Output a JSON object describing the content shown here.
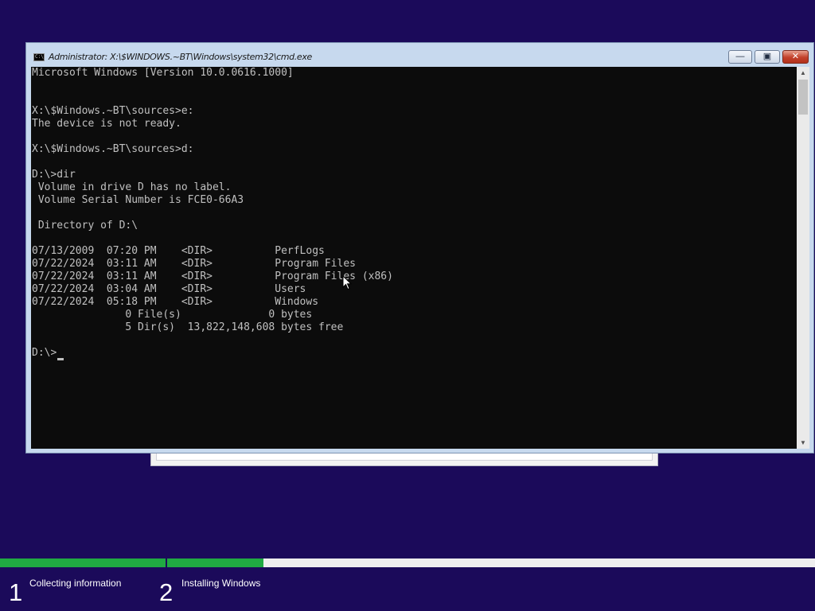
{
  "window": {
    "title": "Administrator: X:\\$WINDOWS.~BT\\Windows\\system32\\cmd.exe",
    "icon_text": "C:\\",
    "minimize_icon": "minimize-icon",
    "maximize_icon": "maximize-icon",
    "close_icon": "close-icon",
    "minimize_glyph": "—",
    "maximize_glyph": "▣",
    "close_glyph": "✕"
  },
  "console": {
    "lines": [
      "Microsoft Windows [Version 10.0.0616.1000]",
      "",
      "",
      "X:\\$Windows.~BT\\sources>e:",
      "The device is not ready.",
      "",
      "X:\\$Windows.~BT\\sources>d:",
      "",
      "D:\\>dir",
      " Volume in drive D has no label.",
      " Volume Serial Number is FCE0-66A3",
      "",
      " Directory of D:\\",
      "",
      "07/13/2009  07:20 PM    <DIR>          PerfLogs",
      "07/22/2024  03:11 AM    <DIR>          Program Files",
      "07/22/2024  03:11 AM    <DIR>          Program Files (x86)",
      "07/22/2024  03:04 AM    <DIR>          Users",
      "07/22/2024  05:18 PM    <DIR>          Windows",
      "               0 File(s)              0 bytes",
      "               5 Dir(s)  13,822,148,608 bytes free",
      "",
      "D:\\>"
    ],
    "text_color": "#c0c0c0",
    "background_color": "#0c0c0c"
  },
  "scrollbar": {
    "up_glyph": "▲",
    "down_glyph": "▼"
  },
  "progress": {
    "fill_color": "#20a942",
    "steps": [
      {
        "number": "1",
        "label": "Collecting information",
        "fill_fraction": 1.0
      },
      {
        "number": "2",
        "label": "Installing Windows",
        "fill_fraction": 0.149
      }
    ]
  }
}
